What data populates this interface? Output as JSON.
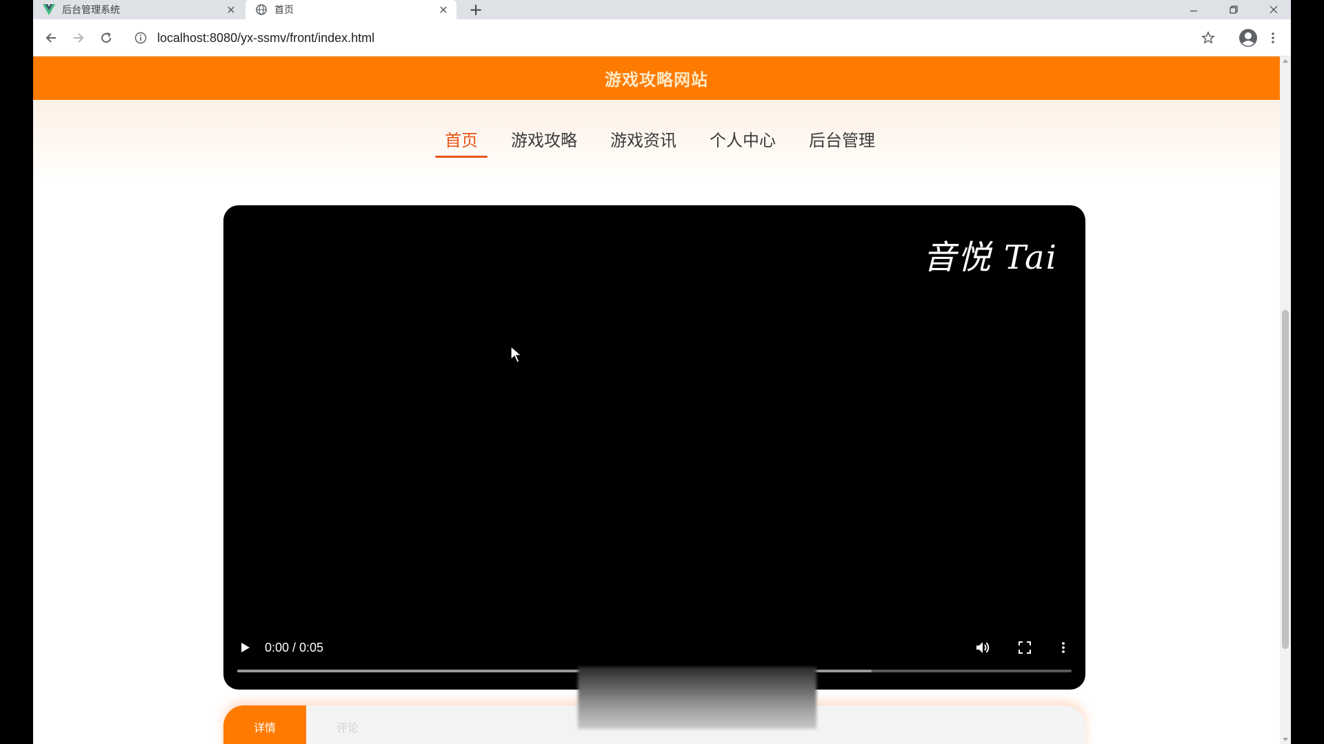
{
  "browser": {
    "tabs": [
      {
        "title": "后台管理系统",
        "favicon": "vue-logo-icon"
      },
      {
        "title": "首页",
        "favicon": "globe-icon"
      }
    ],
    "url": "localhost:8080/yx-ssmv/front/index.html"
  },
  "site": {
    "title": "游戏攻略网站",
    "nav": [
      {
        "label": "首页"
      },
      {
        "label": "游戏攻略"
      },
      {
        "label": "游戏资讯"
      },
      {
        "label": "个人中心"
      },
      {
        "label": "后台管理"
      }
    ],
    "active_nav": "首页"
  },
  "video": {
    "watermark": "音悦 Tai",
    "time": "0:00 / 0:05",
    "buffered_fraction": 0.76
  },
  "detail_tabs": [
    {
      "label": "详情"
    },
    {
      "label": "评论"
    }
  ],
  "colors": {
    "brand_orange": "#ff7a00",
    "nav_active": "#e8551a"
  }
}
